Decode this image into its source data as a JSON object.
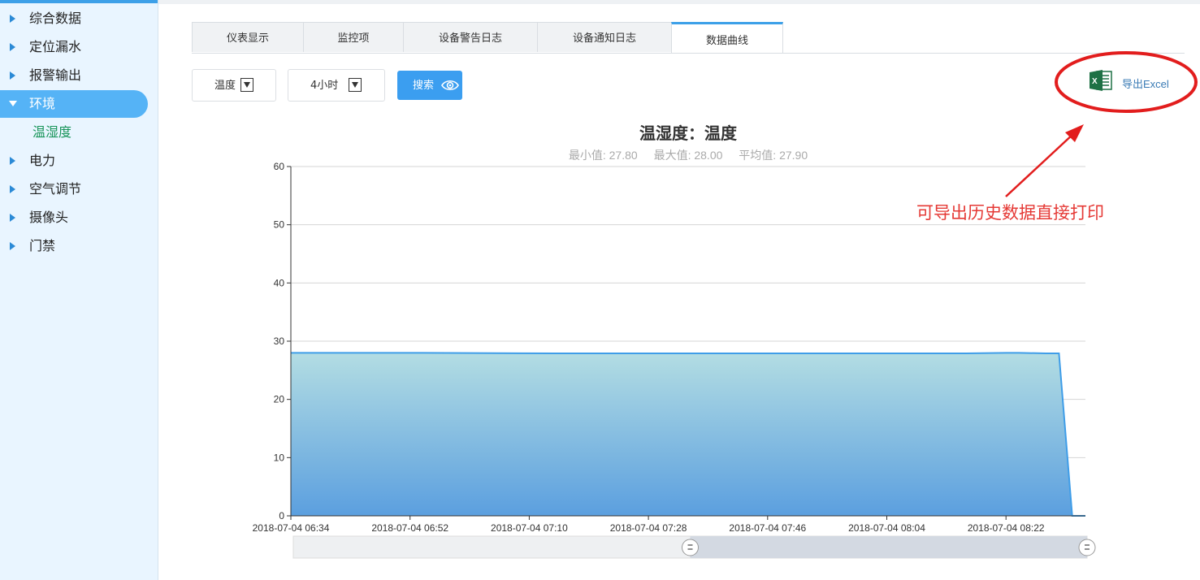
{
  "sidebar": {
    "items": [
      {
        "label": "综合数据"
      },
      {
        "label": "定位漏水"
      },
      {
        "label": "报警输出"
      },
      {
        "label": "环境"
      },
      {
        "label": "电力"
      },
      {
        "label": "空气调节"
      },
      {
        "label": "摄像头"
      },
      {
        "label": "门禁"
      }
    ],
    "active_item": "环境",
    "sub_items": [
      {
        "label": "温湿度"
      }
    ]
  },
  "tabs": [
    {
      "label": "仪表显示"
    },
    {
      "label": "监控项"
    },
    {
      "label": "设备警告日志"
    },
    {
      "label": "设备通知日志"
    },
    {
      "label": "数据曲线"
    }
  ],
  "active_tab": "数据曲线",
  "controls": {
    "metric_select": "温度",
    "range_select": "4小时",
    "search_label": "搜索",
    "export_label": "导出Excel",
    "export_icon": "excel-icon"
  },
  "annotation": {
    "text": "可导出历史数据直接打印",
    "color": "#e53935"
  },
  "colors": {
    "accent": "#3da0e8",
    "area_top": "#b3dde3",
    "area_bottom": "#5b9fdf"
  },
  "chart_data": {
    "type": "area",
    "title": "温湿度：温度",
    "stats": {
      "min_label": "最小值: 27.80",
      "max_label": "最大值: 28.00",
      "avg_label": "平均值: 27.90"
    },
    "y_ticks": [
      "0",
      "10",
      "20",
      "30",
      "40",
      "50",
      "60"
    ],
    "ylim": [
      0,
      60
    ],
    "x_ticks": [
      "2018-07-04 06:34",
      "2018-07-04 06:52",
      "2018-07-04 07:10",
      "2018-07-04 07:28",
      "2018-07-04 07:46",
      "2018-07-04 08:04",
      "2018-07-04 08:22"
    ],
    "x_range_minutes_from_first_tick": [
      0,
      120
    ],
    "series": [
      {
        "x_minutes": [
          0,
          20,
          40,
          60,
          80,
          100,
          102,
          108,
          110,
          114,
          116,
          118,
          120
        ],
        "values": [
          28.0,
          28.0,
          27.9,
          27.9,
          27.9,
          27.9,
          27.9,
          28.0,
          28.0,
          27.9,
          27.9,
          0,
          0
        ]
      }
    ],
    "grid": true,
    "zoom_slider": {
      "start": 0.5,
      "end": 1.0
    }
  }
}
